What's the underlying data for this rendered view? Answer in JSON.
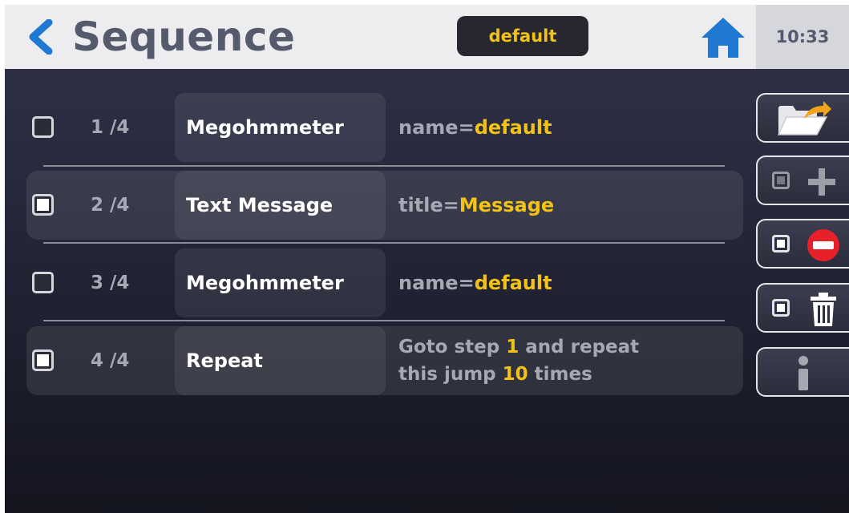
{
  "header": {
    "title": "Sequence",
    "sequence_name": "default",
    "time": "10:33"
  },
  "steps": [
    {
      "index": "1 /4",
      "type": "Megohmmeter",
      "param_key": "name=",
      "param_value": "default",
      "selected": false
    },
    {
      "index": "2 /4",
      "type": "Text Message",
      "param_key": "title=",
      "param_value": "Message",
      "selected": true
    },
    {
      "index": "3 /4",
      "type": "Megohmmeter",
      "param_key": "name=",
      "param_value": "default",
      "selected": false
    },
    {
      "index": "4 /4",
      "type": "Repeat",
      "line1_prefix": "Goto step ",
      "line1_value": "1",
      "line1_suffix": " and repeat",
      "line2_prefix": "this jump ",
      "line2_value": "10",
      "line2_suffix": " times",
      "selected": true
    }
  ],
  "side_buttons": [
    {
      "name": "open-folder-button",
      "icon": "folder-open-icon"
    },
    {
      "name": "add-step-button",
      "icon": "plus-icon"
    },
    {
      "name": "remove-step-button",
      "icon": "minus-circle-icon"
    },
    {
      "name": "delete-button",
      "icon": "trash-icon"
    },
    {
      "name": "info-button",
      "icon": "info-icon"
    }
  ],
  "colors": {
    "accent": "#f2c315",
    "back_arrow": "#1f78d1",
    "home": "#1f78d1",
    "remove_red": "#e8202a"
  }
}
